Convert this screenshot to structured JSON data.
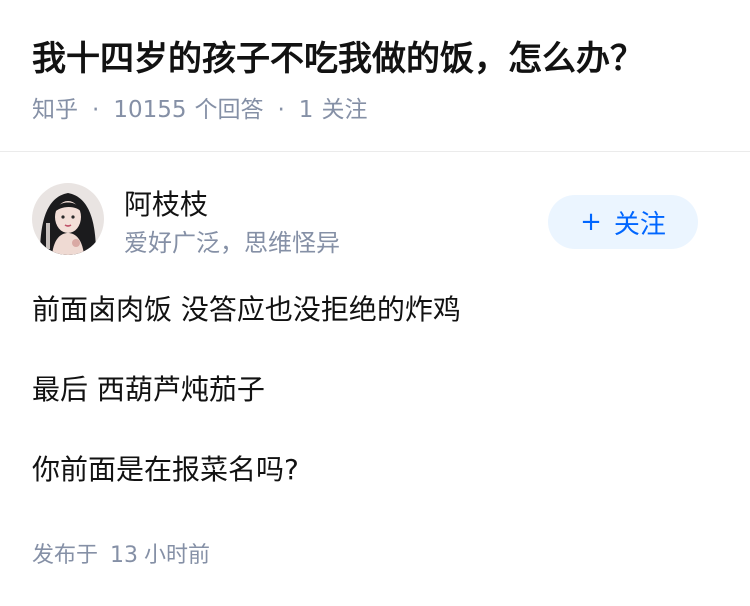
{
  "question": {
    "title": "我十四岁的孩子不吃我做的饭，怎么办？",
    "source": "知乎",
    "separator": "·",
    "answer_count": "10155",
    "answer_label": "个回答",
    "follow_count": "1",
    "follow_label": "关注"
  },
  "answer": {
    "author_name": "阿枝枝",
    "author_bio": "爱好广泛，思维怪异",
    "follow_button": {
      "icon": "+",
      "label": "关注"
    },
    "paragraphs": [
      "前面卤肉饭 没答应也没拒绝的炸鸡",
      "最后 西葫芦炖茄子",
      "你前面是在报菜名吗?"
    ],
    "time_prefix": "发布于",
    "time_value": "13",
    "time_unit": "小时前"
  },
  "colors": {
    "primary": "#0066ff",
    "follow_bg": "#ebf5ff",
    "meta_text": "#8590a6",
    "body_text": "#121212"
  },
  "icons": [
    "plus-icon",
    "avatar-image"
  ]
}
